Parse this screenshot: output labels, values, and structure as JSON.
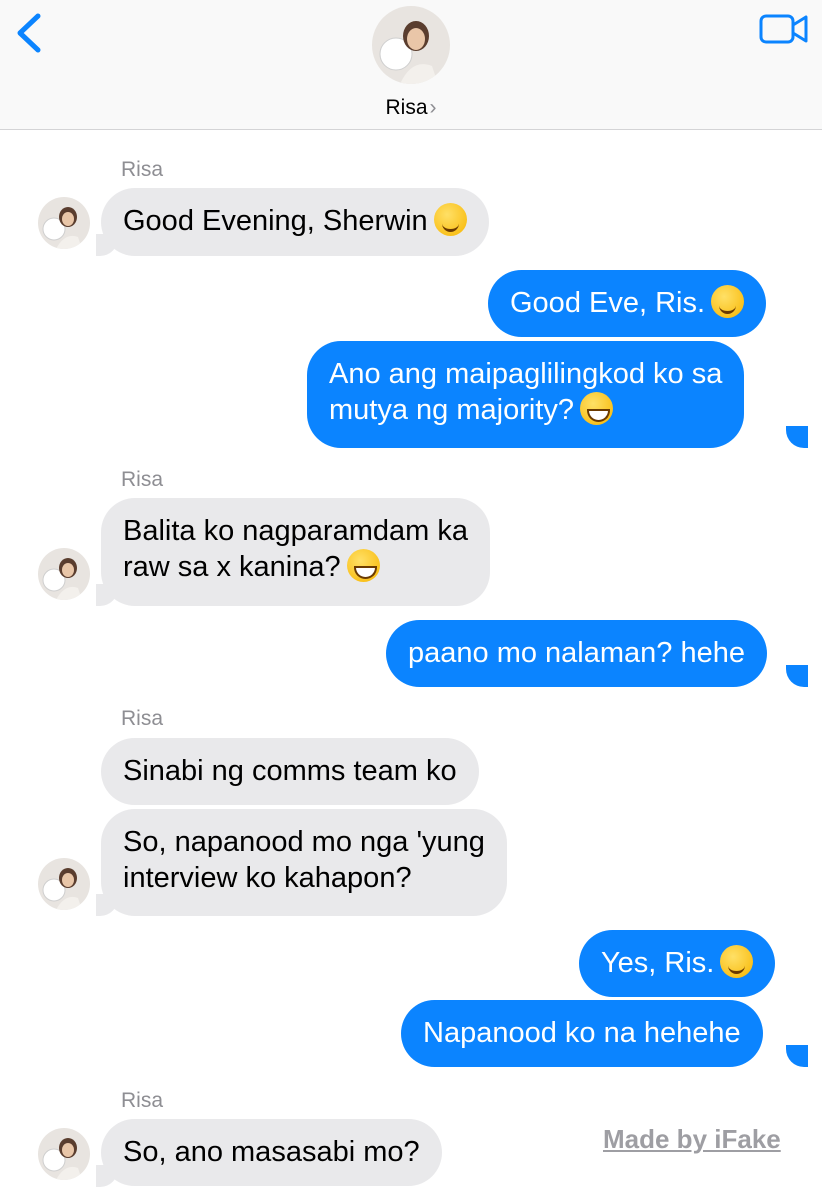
{
  "header": {
    "contact_name": "Risa",
    "chevron": "›",
    "back_icon": "chevron-left-icon",
    "video_icon": "video-camera-icon",
    "accent_color": "#0b84ff"
  },
  "messages": {
    "sender_label_1": "Risa",
    "m1": "Good Evening, Sherwin",
    "m2": "Good Eve, Ris.",
    "m3_line1": "Ano ang maipaglilingkod ko sa",
    "m3_line2": "mutya ng majority?",
    "sender_label_2": "Risa",
    "m4_line1": "Balita ko nagparamdam ka",
    "m4_line2": "raw sa x kanina?",
    "m5": "paano mo nalaman? hehe",
    "sender_label_3": "Risa",
    "m6": "Sinabi ng comms team ko",
    "m7_line1": "So, napanood mo nga 'yung",
    "m7_line2": "interview ko kahapon?",
    "m8": "Yes, Ris.",
    "m9": "Napanood ko na hehehe",
    "sender_label_4": "Risa",
    "m10": "So, ano masasabi mo?"
  },
  "watermark": "Made by iFake",
  "colors": {
    "incoming_bubble": "#e9e9eb",
    "outgoing_bubble": "#0b84ff",
    "label_gray": "#8e8e93"
  }
}
